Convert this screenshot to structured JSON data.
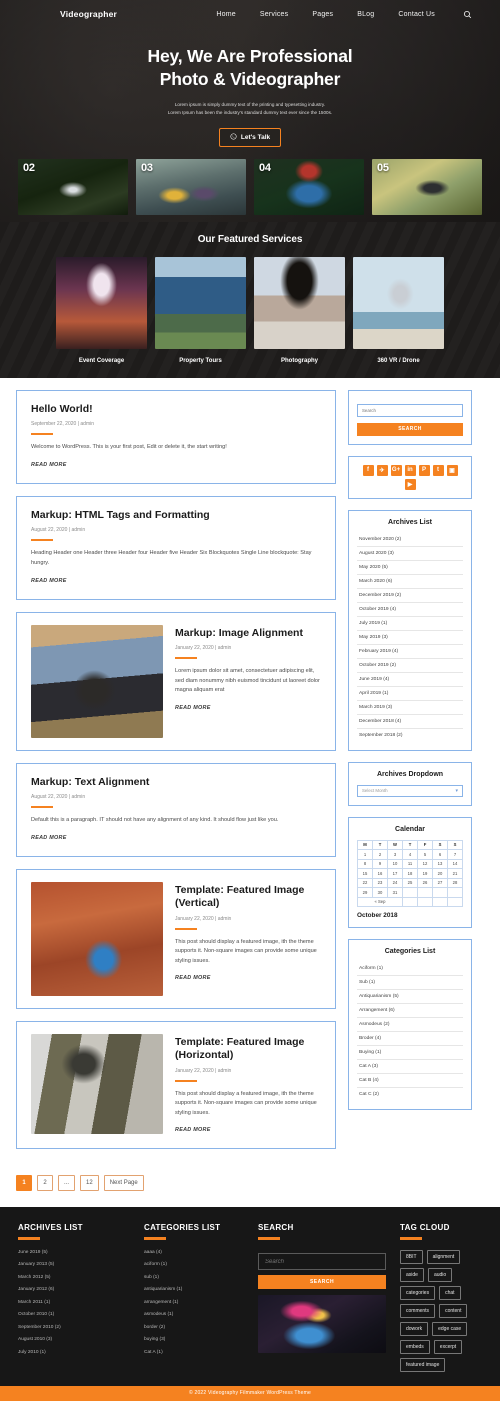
{
  "header": {
    "brand": "Videographer",
    "nav": [
      {
        "label": "Home"
      },
      {
        "label": "Services"
      },
      {
        "label": "Pages"
      },
      {
        "label": "BLog"
      },
      {
        "label": "Contact Us"
      }
    ],
    "search_icon": "search-icon"
  },
  "hero": {
    "title_line1": "Hey, We Are Professional",
    "title_line2": "Photo & Videographer",
    "sub_line1": "Lorem ipsum is simply dummy text of the printing and typesetting industry.",
    "sub_line2": "Lorem Ipsum has been the industry's standard dummy text ever since the 1500s.",
    "cta_label": "Let's Talk",
    "cta_icon": "whatsapp-icon",
    "thumbs": [
      {
        "number": "02",
        "name": "drone-over-forest"
      },
      {
        "number": "03",
        "name": "two-women-in-water"
      },
      {
        "number": "04",
        "name": "photographer-red-beanie"
      },
      {
        "number": "05",
        "name": "action-camera-in-hand"
      }
    ]
  },
  "services": {
    "heading": "Our Featured Services",
    "items": [
      {
        "label": "Event Coverage"
      },
      {
        "label": "Property Tours"
      },
      {
        "label": "Photography"
      },
      {
        "label": "360 VR / Drone"
      }
    ]
  },
  "posts": [
    {
      "title": "Hello World!",
      "meta": "September 22, 2020 | admin",
      "text": "Welcome to WordPress. This is your first post, Edit or delete it, the start writing!",
      "read_more": "READ MORE",
      "layout": "text"
    },
    {
      "title": "Markup: HTML Tags and Formatting",
      "meta": "August 22, 2020 | admin",
      "text": "Heading Header one Header three Header four Header five Header Six Blockquotes Single Line blockquote: Stay hungry.",
      "read_more": "READ MORE",
      "layout": "text"
    },
    {
      "title": "Markup: Image Alignment",
      "meta": "January 22, 2020 | admin",
      "text": "Lorem ipsum dolor sit amet, consectetuer adipiscing elit, sed diam nonummy nibh euismod tincidunt ut laoreet dolor magna aliquam erat",
      "read_more": "READ MORE",
      "layout": "split",
      "image_name": "woman-holding-camera"
    },
    {
      "title": "Markup: Text Alignment",
      "meta": "August 22, 2020 | admin",
      "text": "Default this is a paragraph. IT should not have any alignment of any kind. It should flow just like you.",
      "read_more": "READ MORE",
      "layout": "text"
    },
    {
      "title": "Template: Featured Image (Vertical)",
      "meta": "January 22, 2020 | admin",
      "text": "This post should display a featured image, ith the theme supports it. Non-square images can provide some unique styling issues.",
      "read_more": "READ MORE",
      "layout": "split",
      "image_name": "photographer-red-rocks"
    },
    {
      "title": "Template: Featured Image (Horizontal)",
      "meta": "January 22, 2020 | admin",
      "text": "This post should display a featured image, ith the theme supports it. Non-square images can provide some unique styling issues.",
      "read_more": "READ MORE",
      "layout": "split",
      "image_name": "photographer-palm-trees"
    }
  ],
  "pagination": [
    {
      "label": "1",
      "active": true
    },
    {
      "label": "2",
      "active": false
    },
    {
      "label": "...",
      "active": false
    },
    {
      "label": "12",
      "active": false
    },
    {
      "label": "Next Page",
      "active": false
    }
  ],
  "sidebar": {
    "search": {
      "placeholder": "Search",
      "button_label": "SEARCH"
    },
    "social": [
      {
        "glyph": "f",
        "name": "facebook-icon"
      },
      {
        "glyph": "✈",
        "name": "twitter-icon"
      },
      {
        "glyph": "G+",
        "name": "google-plus-icon"
      },
      {
        "glyph": "in",
        "name": "linkedin-icon"
      },
      {
        "glyph": "P",
        "name": "pinterest-icon"
      },
      {
        "glyph": "t",
        "name": "tumblr-icon"
      },
      {
        "glyph": "▣",
        "name": "instagram-icon"
      },
      {
        "glyph": "▶",
        "name": "youtube-icon"
      }
    ],
    "archives": {
      "title": "Archives List",
      "items": [
        "November 2020 (2)",
        "August 2020 (3)",
        "May 2020 (5)",
        "March 2020 (6)",
        "December 2019 (2)",
        "October 2019 (4)",
        "July 2019 (1)",
        "May 2019 (3)",
        "February 2019 (4)",
        "October 2019 (2)",
        "June 2019 (4)",
        "April 2019 (1)",
        "March 2019 (3)",
        "December 2018 (4)",
        "September 2018 (2)"
      ]
    },
    "archives_dropdown": {
      "title": "Archives Dropdown",
      "selected": "Select Month"
    },
    "calendar": {
      "title": "Calendar",
      "weekdays": [
        "M",
        "T",
        "W",
        "T",
        "F",
        "S",
        "S"
      ],
      "weeks": [
        [
          "1",
          "2",
          "3",
          "4",
          "5",
          "6",
          "7"
        ],
        [
          "8",
          "9",
          "10",
          "11",
          "12",
          "13",
          "14"
        ],
        [
          "15",
          "16",
          "17",
          "18",
          "19",
          "20",
          "21"
        ],
        [
          "22",
          "23",
          "24",
          "25",
          "26",
          "27",
          "28"
        ],
        [
          "29",
          "30",
          "31",
          "",
          "",
          "",
          ""
        ]
      ],
      "prev_label": "« Sep",
      "caption": "October 2018"
    },
    "categories": {
      "title": "Categories List",
      "items": [
        "Aciform (1)",
        "Sub (1)",
        "Antiquarianism (5)",
        "Arrangement (6)",
        "Asmodeus (2)",
        "Broder (4)",
        "Buying (1)",
        "Cat A (3)",
        "Cat B (4)",
        "Cat C (2)"
      ]
    }
  },
  "footer": {
    "archives": {
      "title": "ARCHIVES LIST",
      "items": [
        "June 2019 (5)",
        "January  2013 (5)",
        "March 2012 (5)",
        "January  2012 (6)",
        "March  2011 (1)",
        "October 2010 (1)",
        "September 2010 (2)",
        "August 2010 (3)",
        "July 2010 (1)"
      ]
    },
    "categories": {
      "title": "CATEGORIES LIST",
      "items": [
        "aaaa (4)",
        "aciform (1)",
        "sub (1)",
        "antiquarianism (1)",
        "arrangement (1)",
        "asmodeus (1)",
        "border (2)",
        "buying (3)",
        "Cat A (1)"
      ]
    },
    "search": {
      "title": "SEARCH",
      "placeholder": "Search",
      "button_label": "SEARCH",
      "image_name": "stage-camera-performer"
    },
    "tags": {
      "title": "TAG CLOUD",
      "items": [
        "8BIT",
        "alignment",
        "aside",
        "audio",
        "categories",
        "chat",
        "comments",
        "content",
        "dowork",
        "edge case",
        "embeds",
        "excerpt",
        "featured image"
      ]
    },
    "copyright": "© 2022 Videography Filmmaker WordPress Theme"
  },
  "colors": {
    "accent": "#f58220",
    "card_border": "#8ab4e8",
    "dark": "#171717"
  }
}
